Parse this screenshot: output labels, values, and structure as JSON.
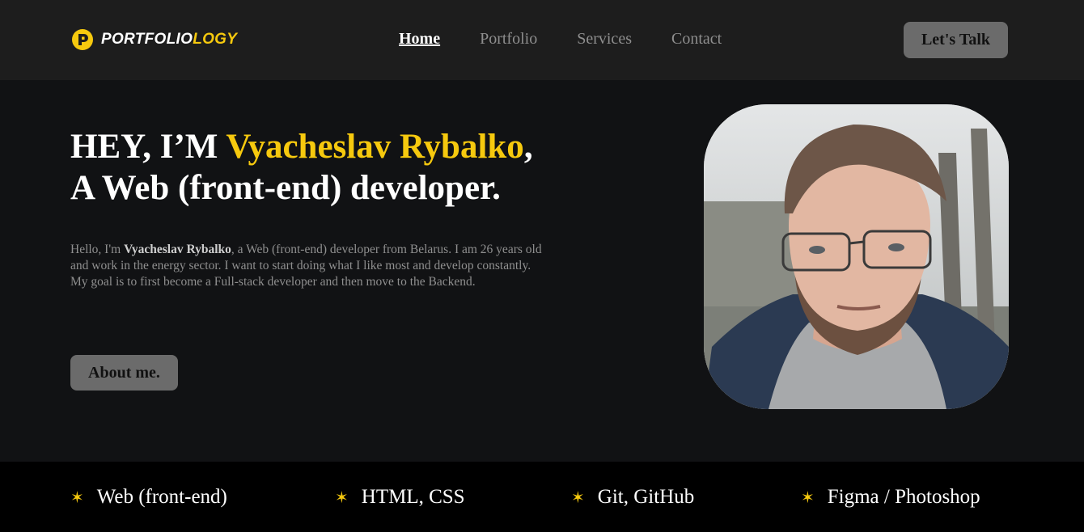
{
  "header": {
    "logo": {
      "text_part1": "PORTFOLIO",
      "text_part2": "LOGY",
      "icon": "logo-p-icon"
    },
    "nav": [
      {
        "label": "Home",
        "active": true
      },
      {
        "label": "Portfolio",
        "active": false
      },
      {
        "label": "Services",
        "active": false
      },
      {
        "label": "Contact",
        "active": false
      }
    ],
    "cta_label": "Let's Talk"
  },
  "hero": {
    "title_prefix": "HEY, I’M ",
    "title_name": "Vyacheslav Rybalko",
    "title_comma": ",",
    "title_line2": "A Web (front-end) developer.",
    "desc_before": "Hello, I'm ",
    "desc_name": "Vyacheslav Rybalko",
    "desc_after": ", a Web (front-end) developer from Belarus. I am 26 years old and work in the energy sector. I want to start doing what I like most and develop constantly. My goal is to first become a Full-stack developer and then move to the Backend.",
    "about_label": "About me."
  },
  "skills": [
    {
      "icon": "star-icon",
      "symbol": "✶",
      "label": "Web (front-end)"
    },
    {
      "icon": "star-icon",
      "symbol": "✶",
      "label": "HTML, CSS"
    },
    {
      "icon": "star-icon",
      "symbol": "✶",
      "label": "Git, GitHub"
    },
    {
      "icon": "star-icon",
      "symbol": "✶",
      "label": "Figma / Photoshop"
    }
  ],
  "colors": {
    "accent": "#f6c90e",
    "header_bg": "#1d1d1d",
    "page_bg": "#111214",
    "strip_bg": "#000000",
    "button_bg": "#6b6b6b"
  }
}
